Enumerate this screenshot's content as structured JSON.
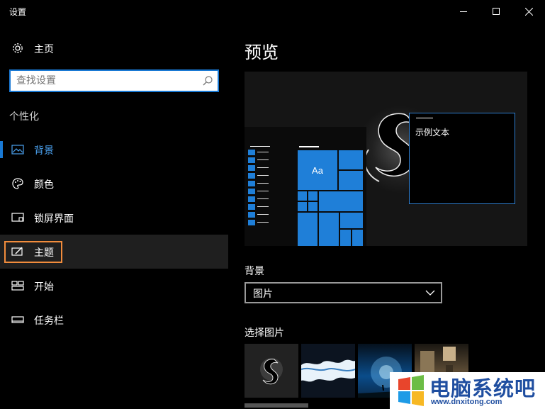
{
  "window": {
    "title": "设置",
    "controls": [
      "minimize-icon",
      "maximize-icon",
      "close-icon"
    ]
  },
  "sidebar": {
    "home_label": "主页",
    "search_placeholder": "查找设置",
    "section_title": "个性化",
    "items": [
      {
        "label": "背景",
        "icon": "image-icon",
        "selected": true
      },
      {
        "label": "颜色",
        "icon": "palette-icon",
        "selected": false
      },
      {
        "label": "锁屏界面",
        "icon": "lock-screen-icon",
        "selected": false
      },
      {
        "label": "主题",
        "icon": "theme-icon",
        "selected": false,
        "highlighted": true
      },
      {
        "label": "开始",
        "icon": "start-icon",
        "selected": false
      },
      {
        "label": "任务栏",
        "icon": "taskbar-icon",
        "selected": false
      }
    ]
  },
  "main": {
    "preview_title": "预览",
    "preview_tile_label": "Aa",
    "preview_window_text": "示例文本",
    "background_label": "背景",
    "background_value": "图片",
    "choose_picture_label": "选择图片"
  },
  "watermark": {
    "title": "电脑系统吧",
    "url": "www.dnxitong.com"
  },
  "colors": {
    "accent": "#1979d4",
    "highlight_box": "#f28c3c",
    "tile_blue": "#1f7fd8"
  }
}
